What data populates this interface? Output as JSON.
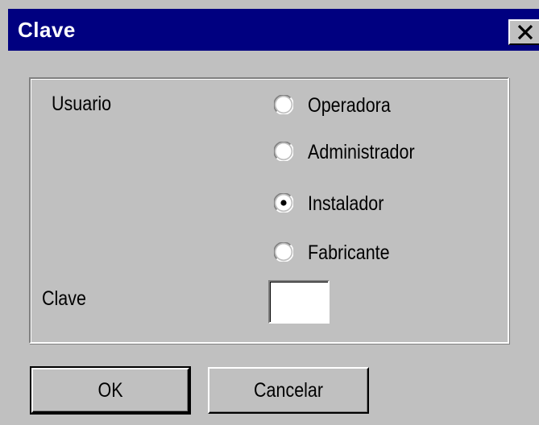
{
  "window": {
    "title": "Clave",
    "close_glyph": "close-icon"
  },
  "form": {
    "user_label": "Usuario",
    "password_label": "Clave",
    "password_value": "",
    "roles": [
      {
        "label": "Operadora",
        "selected": false
      },
      {
        "label": "Administrador",
        "selected": false
      },
      {
        "label": "Instalador",
        "selected": true
      },
      {
        "label": "Fabricante",
        "selected": false
      }
    ]
  },
  "buttons": {
    "ok_label": "OK",
    "cancel_label": "Cancelar"
  },
  "colors": {
    "titlebar": "#000080",
    "face": "#c0c0c0",
    "highlight": "#ffffff",
    "shadow": "#808080",
    "dark_shadow": "#000000"
  }
}
